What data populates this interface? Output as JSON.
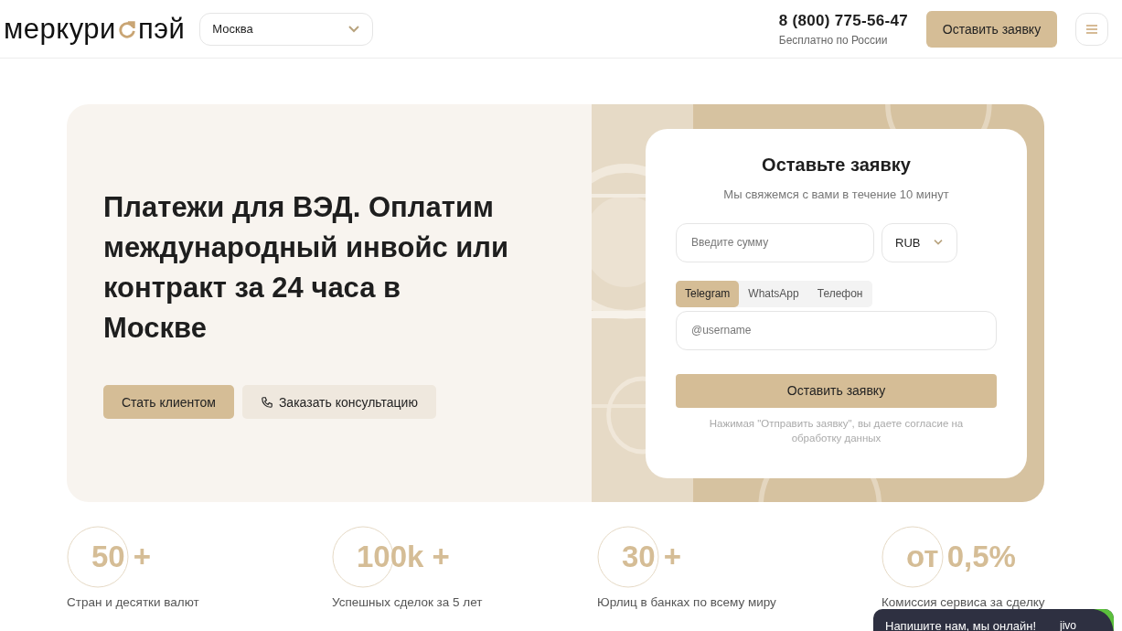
{
  "header": {
    "logo": {
      "left": "меркури",
      "right": "пэй"
    },
    "city_select": {
      "value": "Москва"
    },
    "phone": "8 (800) 775-56-47",
    "phone_note": "Бесплатно по России",
    "cta": "Оставить заявку"
  },
  "hero": {
    "title": "Платежи для ВЭД. Оплатим международный инвойс или контракт за 24 часа в Москве",
    "buttons": [
      {
        "label": "Стать клиентом",
        "kind": "primary"
      },
      {
        "label": "Заказать консультацию",
        "kind": "phone"
      }
    ]
  },
  "form": {
    "title": "Оставьте заявку",
    "subtitle": "Мы свяжемся с вами в течение 10 минут",
    "amount": {
      "placeholder": "Введите сумму"
    },
    "currency": "RUB",
    "tabs": [
      {
        "label": "Telegram",
        "selected": true
      },
      {
        "label": "WhatsApp",
        "selected": false
      },
      {
        "label": "Телефон",
        "selected": false
      }
    ],
    "contact": {
      "placeholder": "@username"
    },
    "submit": "Оставить заявку",
    "consent": "Нажимая \"Отправить заявку\", вы даете согласие на обработку данных"
  },
  "stats": [
    {
      "value": "50 +",
      "label": "Стран и десятки валют"
    },
    {
      "value": "100k +",
      "label": "Успешных сделок за 5 лет"
    },
    {
      "value": "30 +",
      "label": "Юрлиц в банках по всему миру"
    },
    {
      "value": "от 0,5%",
      "label": "Комиссия сервиса за сделку"
    }
  ],
  "chat": {
    "text": "Напишите нам, мы онлайн!",
    "brand": "jivo"
  }
}
